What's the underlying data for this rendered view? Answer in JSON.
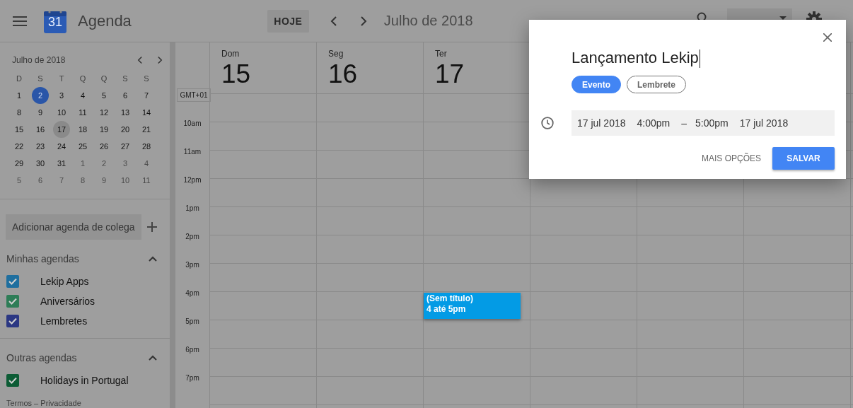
{
  "header": {
    "logo_day": "31",
    "title": "Agenda",
    "today_button": "HOJE",
    "range": "Julho de 2018"
  },
  "mini_calendar": {
    "title": "Julho de 2018",
    "weekdays": [
      "D",
      "S",
      "T",
      "Q",
      "Q",
      "S",
      "S"
    ],
    "weeks": [
      [
        {
          "label": "1",
          "in_month": true,
          "today": false,
          "selected": false
        },
        {
          "label": "2",
          "in_month": true,
          "today": true,
          "selected": false
        },
        {
          "label": "3",
          "in_month": true,
          "today": false,
          "selected": false
        },
        {
          "label": "4",
          "in_month": true,
          "today": false,
          "selected": false
        },
        {
          "label": "5",
          "in_month": true,
          "today": false,
          "selected": false
        },
        {
          "label": "6",
          "in_month": true,
          "today": false,
          "selected": false
        },
        {
          "label": "7",
          "in_month": true,
          "today": false,
          "selected": false
        }
      ],
      [
        {
          "label": "8",
          "in_month": true,
          "today": false,
          "selected": false
        },
        {
          "label": "9",
          "in_month": true,
          "today": false,
          "selected": false
        },
        {
          "label": "10",
          "in_month": true,
          "today": false,
          "selected": false
        },
        {
          "label": "11",
          "in_month": true,
          "today": false,
          "selected": false
        },
        {
          "label": "12",
          "in_month": true,
          "today": false,
          "selected": false
        },
        {
          "label": "13",
          "in_month": true,
          "today": false,
          "selected": false
        },
        {
          "label": "14",
          "in_month": true,
          "today": false,
          "selected": false
        }
      ],
      [
        {
          "label": "15",
          "in_month": true,
          "today": false,
          "selected": false
        },
        {
          "label": "16",
          "in_month": true,
          "today": false,
          "selected": false
        },
        {
          "label": "17",
          "in_month": true,
          "today": false,
          "selected": true
        },
        {
          "label": "18",
          "in_month": true,
          "today": false,
          "selected": false
        },
        {
          "label": "19",
          "in_month": true,
          "today": false,
          "selected": false
        },
        {
          "label": "20",
          "in_month": true,
          "today": false,
          "selected": false
        },
        {
          "label": "21",
          "in_month": true,
          "today": false,
          "selected": false
        }
      ],
      [
        {
          "label": "22",
          "in_month": true,
          "today": false,
          "selected": false
        },
        {
          "label": "23",
          "in_month": true,
          "today": false,
          "selected": false
        },
        {
          "label": "24",
          "in_month": true,
          "today": false,
          "selected": false
        },
        {
          "label": "25",
          "in_month": true,
          "today": false,
          "selected": false
        },
        {
          "label": "26",
          "in_month": true,
          "today": false,
          "selected": false
        },
        {
          "label": "27",
          "in_month": true,
          "today": false,
          "selected": false
        },
        {
          "label": "28",
          "in_month": true,
          "today": false,
          "selected": false
        }
      ],
      [
        {
          "label": "29",
          "in_month": true,
          "today": false,
          "selected": false
        },
        {
          "label": "30",
          "in_month": true,
          "today": false,
          "selected": false
        },
        {
          "label": "31",
          "in_month": true,
          "today": false,
          "selected": false
        },
        {
          "label": "1",
          "in_month": false,
          "today": false,
          "selected": false
        },
        {
          "label": "2",
          "in_month": false,
          "today": false,
          "selected": false
        },
        {
          "label": "3",
          "in_month": false,
          "today": false,
          "selected": false
        },
        {
          "label": "4",
          "in_month": false,
          "today": false,
          "selected": false
        }
      ],
      [
        {
          "label": "5",
          "in_month": false,
          "today": false,
          "selected": false
        },
        {
          "label": "6",
          "in_month": false,
          "today": false,
          "selected": false
        },
        {
          "label": "7",
          "in_month": false,
          "today": false,
          "selected": false
        },
        {
          "label": "8",
          "in_month": false,
          "today": false,
          "selected": false
        },
        {
          "label": "9",
          "in_month": false,
          "today": false,
          "selected": false
        },
        {
          "label": "10",
          "in_month": false,
          "today": false,
          "selected": false
        },
        {
          "label": "11",
          "in_month": false,
          "today": false,
          "selected": false
        }
      ]
    ]
  },
  "sidebar": {
    "add_field": {
      "placeholder": "Adicionar agenda de colega"
    },
    "sections": [
      {
        "title": "Minhas agendas",
        "expanded": true,
        "calendars": [
          {
            "name": "Lekip Apps",
            "checked": true,
            "color": "#1f6f9f"
          },
          {
            "name": "Aniversários",
            "checked": true,
            "color": "#2e7d57"
          },
          {
            "name": "Lembretes",
            "checked": true,
            "color": "#2b3783"
          }
        ]
      },
      {
        "title": "Outras agendas",
        "expanded": true,
        "calendars": [
          {
            "name": "Holidays in Portugal",
            "checked": true,
            "color": "#0c5c35"
          }
        ]
      }
    ],
    "footer": "Termos – Privacidade"
  },
  "week": {
    "timezone": "GMT+01",
    "days": [
      {
        "weekday": "Dom",
        "date": "15"
      },
      {
        "weekday": "Seg",
        "date": "16"
      },
      {
        "weekday": "Ter",
        "date": "17",
        "events": [
          {
            "title": "(Sem título)",
            "time": "4 até 5pm"
          }
        ]
      }
    ],
    "hours": [
      "10am",
      "11am",
      "12pm",
      "1pm",
      "2pm",
      "3pm",
      "4pm",
      "5pm",
      "6pm",
      "7pm"
    ]
  },
  "dialog": {
    "title": "Lançamento Lekip",
    "types": [
      {
        "label": "Evento",
        "selected": true
      },
      {
        "label": "Lembrete",
        "selected": false
      }
    ],
    "start_date": "17 jul 2018",
    "start_time": "4:00pm",
    "separator": "–",
    "end_time": "5:00pm",
    "end_date": "17 jul 2018",
    "more_button": "MAIS OPÇÕES",
    "save_button": "SALVAR"
  }
}
